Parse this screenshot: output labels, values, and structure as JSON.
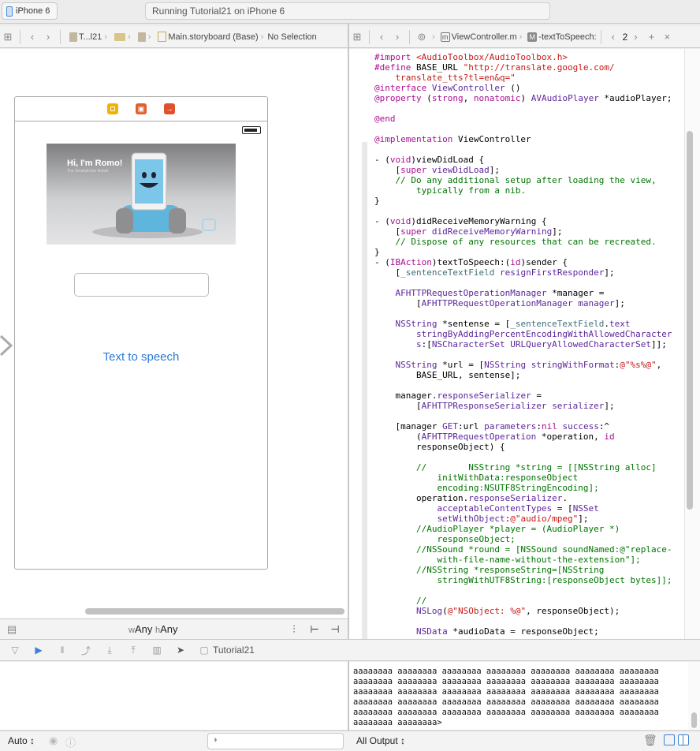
{
  "toolbar": {
    "scheme_label": "iPhone 6",
    "activity_text": "Running Tutorial21 on iPhone 6"
  },
  "jump_left": {
    "crumbs": [
      "T...l21",
      "Main.storyboard (Base)",
      "No Selection"
    ]
  },
  "jump_right": {
    "file": "ViewController.m",
    "method": "-textToSpeech:",
    "counter": "2"
  },
  "scene": {
    "romo_title": "Hi, I'm Romo!",
    "romo_subtitle": "The Smartphone Robot",
    "button_label": "Text to speech",
    "textfield_value": ""
  },
  "size_class": {
    "w_prefix": "w",
    "w_value": "Any",
    "h_prefix": "h",
    "h_value": "Any"
  },
  "debug": {
    "target": "Tutorial21"
  },
  "console": {
    "lines": [
      "aaaaaaaa aaaaaaaa aaaaaaaa aaaaaaaa aaaaaaaa aaaaaaaa aaaaaaaa",
      "aaaaaaaa aaaaaaaa aaaaaaaa aaaaaaaa aaaaaaaa aaaaaaaa aaaaaaaa",
      "aaaaaaaa aaaaaaaa aaaaaaaa aaaaaaaa aaaaaaaa aaaaaaaa aaaaaaaa",
      "aaaaaaaa aaaaaaaa aaaaaaaa aaaaaaaa aaaaaaaa aaaaaaaa aaaaaaaa",
      "aaaaaaaa aaaaaaaa aaaaaaaa aaaaaaaa aaaaaaaa aaaaaaaa aaaaaaaa",
      "aaaaaaaa aaaaaaaa>"
    ]
  },
  "bottom": {
    "auto_label": "Auto",
    "output_label": "All Output"
  },
  "icons": {
    "device": "iphone-icon",
    "grid": "grid-icon",
    "back": "chevron-left-icon",
    "forward": "chevron-right-icon",
    "trash": "trash-icon",
    "eye": "eye-icon",
    "info": "info-icon"
  }
}
